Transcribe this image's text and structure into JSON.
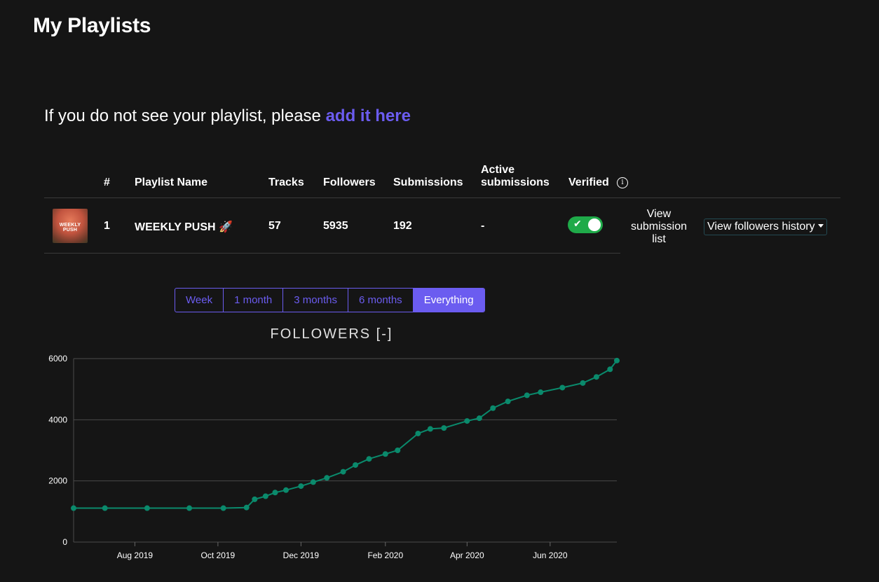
{
  "page": {
    "title": "My Playlists"
  },
  "notice": {
    "text": "If you do not see your playlist, please ",
    "link": "add it here"
  },
  "table": {
    "headers": {
      "num": "#",
      "name": "Playlist Name",
      "tracks": "Tracks",
      "followers": "Followers",
      "submissions": "Submissions",
      "active_line1": "Active",
      "active_line2": "submissions",
      "verified": "Verified"
    },
    "rows": [
      {
        "thumb_text": "WEEKLY PUSH",
        "num": "1",
        "name": "WEEKLY PUSH 🚀",
        "tracks": "57",
        "followers": "5935",
        "submissions": "192",
        "active": "-",
        "verified": true,
        "view_submission": "View submission list",
        "view_history": "View followers history"
      }
    ]
  },
  "range_selector": {
    "options": [
      "Week",
      "1 month",
      "3 months",
      "6 months",
      "Everything"
    ],
    "selected": "Everything"
  },
  "colors": {
    "accent": "#6b5cf0",
    "line": "#0a8a6c",
    "verified": "#1faa49"
  },
  "chart_data": {
    "type": "line",
    "title": "FOLLOWERS [-]",
    "x_ticks": [
      "Aug 2019",
      "Oct 2019",
      "Dec 2019",
      "Feb 2020",
      "Apr 2020",
      "Jun 2020"
    ],
    "y_ticks": [
      "0",
      "2000",
      "4000",
      "6000"
    ],
    "ylim": [
      0,
      6000
    ],
    "xlim": [
      "2019-06-17",
      "2020-07-20"
    ],
    "grid": true,
    "series": [
      {
        "x": [
          "2019-06-17",
          "2019-07-10",
          "2019-08-10",
          "2019-09-10",
          "2019-10-05",
          "2019-10-22",
          "2019-10-28",
          "2019-11-05",
          "2019-11-12",
          "2019-11-20",
          "2019-12-01",
          "2019-12-10",
          "2019-12-20",
          "2020-01-01",
          "2020-01-10",
          "2020-01-20",
          "2020-02-01",
          "2020-02-10",
          "2020-02-25",
          "2020-03-05",
          "2020-03-15",
          "2020-04-01",
          "2020-04-10",
          "2020-04-20",
          "2020-05-01",
          "2020-05-15",
          "2020-05-25",
          "2020-06-10",
          "2020-06-25",
          "2020-07-05",
          "2020-07-15",
          "2020-07-20"
        ],
        "y": [
          1110,
          1110,
          1110,
          1110,
          1110,
          1130,
          1400,
          1500,
          1620,
          1700,
          1830,
          1960,
          2100,
          2300,
          2520,
          2720,
          2880,
          3000,
          3550,
          3700,
          3730,
          3960,
          4050,
          4380,
          4600,
          4800,
          4900,
          5050,
          5200,
          5400,
          5650,
          5935
        ]
      }
    ]
  }
}
